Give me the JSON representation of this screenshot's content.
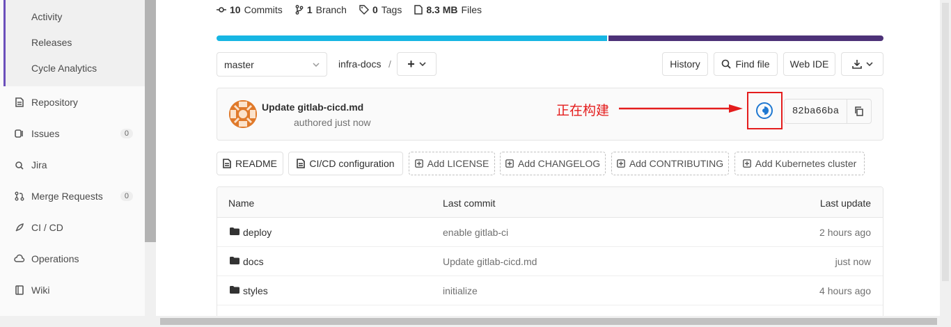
{
  "sidebar": {
    "sub_items": [
      "Activity",
      "Releases",
      "Cycle Analytics"
    ],
    "items": [
      {
        "label": "Repository",
        "icon": "document-icon"
      },
      {
        "label": "Issues",
        "icon": "issues-icon",
        "count": "0"
      },
      {
        "label": "Jira",
        "icon": "jira-icon"
      },
      {
        "label": "Merge Requests",
        "icon": "merge-request-icon",
        "count": "0"
      },
      {
        "label": "CI / CD",
        "icon": "rocket-icon"
      },
      {
        "label": "Operations",
        "icon": "cloud-gear-icon"
      },
      {
        "label": "Wiki",
        "icon": "book-icon"
      }
    ]
  },
  "stats": {
    "commits_n": "10",
    "commits_label": "Commits",
    "branch_n": "1",
    "branch_label": "Branch",
    "tags_n": "0",
    "tags_label": "Tags",
    "size_n": "8.3 MB",
    "size_label": "Files"
  },
  "language_bar": {
    "colors": [
      "#17b6e3",
      "#4d3278"
    ],
    "fractions": [
      0.585,
      0.415
    ]
  },
  "toolbar": {
    "branch": "master",
    "path": "infra-docs",
    "path_sep": "/",
    "add_label": "+",
    "history": "History",
    "find_file": "Find file",
    "web_ide": "Web IDE"
  },
  "commit": {
    "title": "Update gitlab-cicd.md",
    "meta": "authored just now",
    "sha": "82ba66ba",
    "status": "running"
  },
  "annotation": "正在构建",
  "buttons": {
    "readme": "README",
    "cicd": "CI/CD configuration",
    "license": "Add LICENSE",
    "changelog": "Add CHANGELOG",
    "contributing": "Add CONTRIBUTING",
    "kubernetes": "Add Kubernetes cluster"
  },
  "table": {
    "headers": {
      "name": "Name",
      "last_commit": "Last commit",
      "last_update": "Last update"
    },
    "rows": [
      {
        "name": "deploy",
        "commit": "enable gitlab-ci",
        "updated": "2 hours ago"
      },
      {
        "name": "docs",
        "commit": "Update gitlab-cicd.md",
        "updated": "just now"
      },
      {
        "name": "styles",
        "commit": "initialize",
        "updated": "4 hours ago"
      }
    ]
  },
  "accent": {
    "brand": "#6b4fbb",
    "link": "#1f78d1",
    "annotation": "#e41d1d"
  }
}
